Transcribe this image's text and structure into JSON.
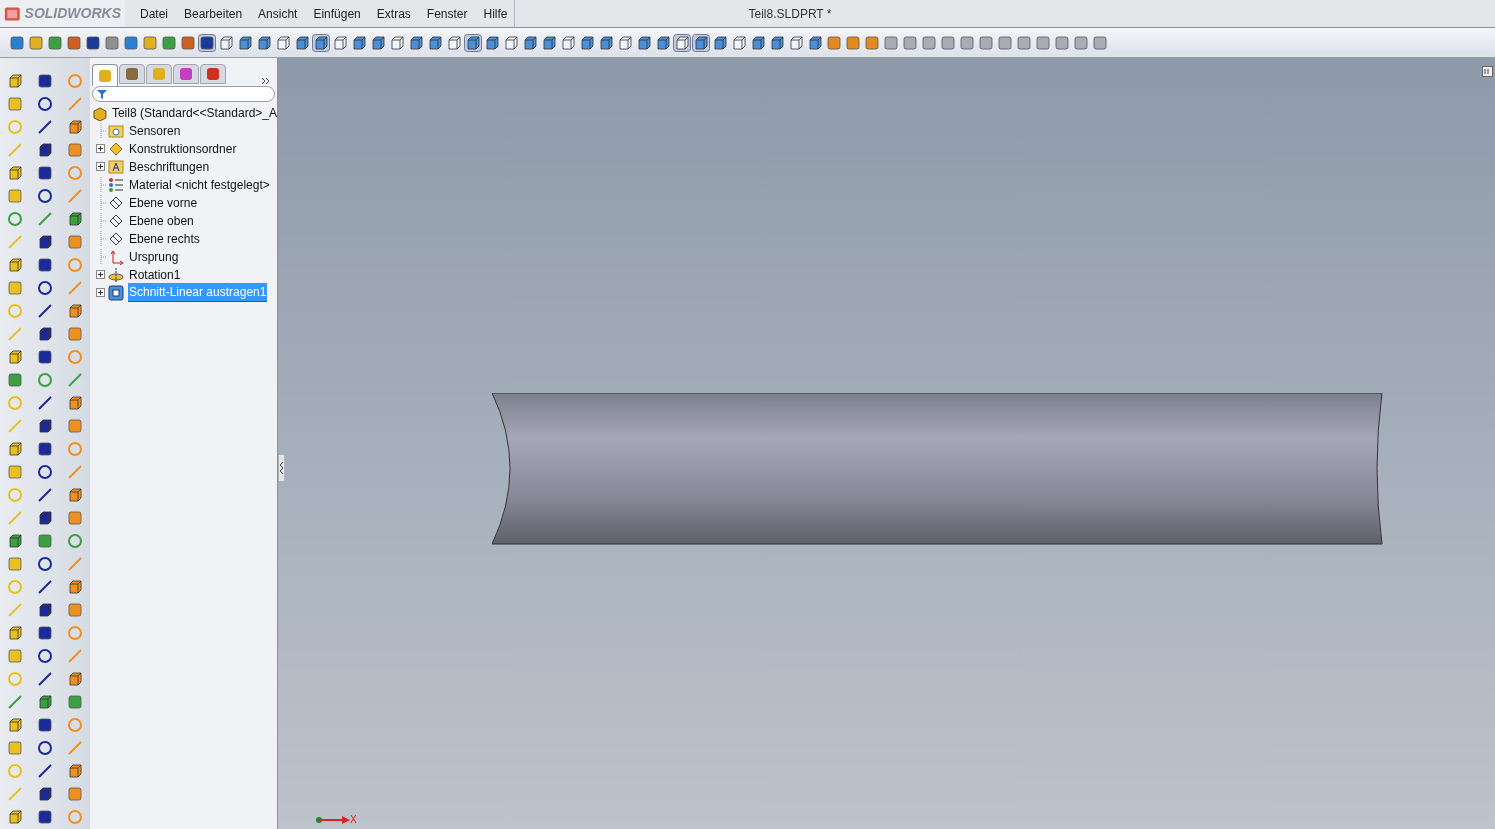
{
  "app": {
    "name": "SOLIDWORKS"
  },
  "menu": [
    {
      "label": "Datei"
    },
    {
      "label": "Bearbeiten"
    },
    {
      "label": "Ansicht"
    },
    {
      "label": "Einfügen"
    },
    {
      "label": "Extras"
    },
    {
      "label": "Fenster"
    },
    {
      "label": "Hilfe"
    }
  ],
  "window": {
    "title": "Teil8.SLDPRT *"
  },
  "panel_tabs": [
    {
      "selected": true
    },
    {
      "selected": false
    },
    {
      "selected": false
    },
    {
      "selected": false
    },
    {
      "selected": false
    }
  ],
  "tree": {
    "root": "Teil8  (Standard<<Standard>_A",
    "children": [
      {
        "label": "Sensoren",
        "kind": "sensor",
        "expandable": false,
        "selected": false
      },
      {
        "label": "Konstruktionsordner",
        "kind": "folder",
        "expandable": true,
        "selected": false
      },
      {
        "label": "Beschriftungen",
        "kind": "annotation",
        "expandable": true,
        "selected": false
      },
      {
        "label": "Material <nicht festgelegt>",
        "kind": "material",
        "expandable": false,
        "selected": false
      },
      {
        "label": "Ebene vorne",
        "kind": "plane",
        "expandable": false,
        "selected": false
      },
      {
        "label": "Ebene oben",
        "kind": "plane",
        "expandable": false,
        "selected": false
      },
      {
        "label": "Ebene rechts",
        "kind": "plane",
        "expandable": false,
        "selected": false
      },
      {
        "label": "Ursprung",
        "kind": "origin",
        "expandable": false,
        "selected": false
      },
      {
        "label": "Rotation1",
        "kind": "revolve",
        "expandable": true,
        "selected": false
      },
      {
        "label": "Schnitt-Linear austragen1",
        "kind": "cut",
        "expandable": true,
        "selected": true
      }
    ]
  },
  "triad": {
    "axis": "X"
  }
}
